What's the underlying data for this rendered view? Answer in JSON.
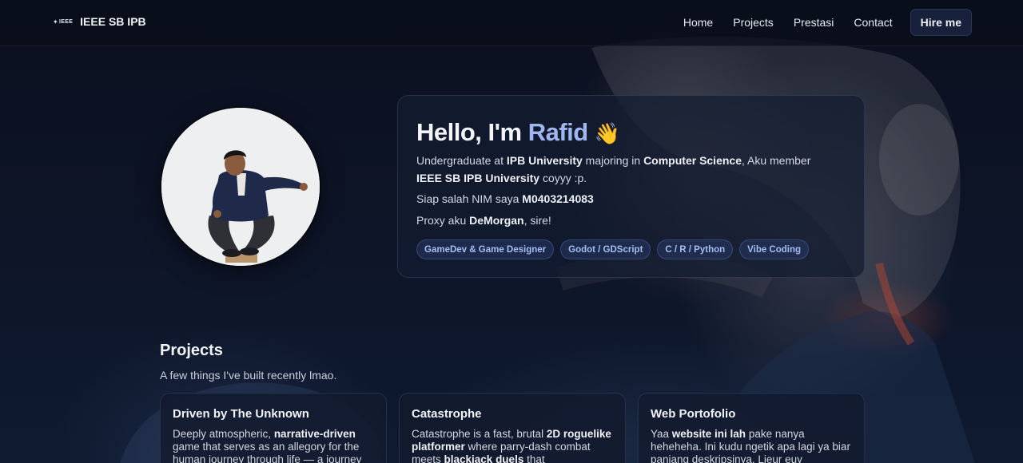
{
  "header": {
    "logo_text": "IEEE",
    "brand": "IEEE SB IPB",
    "nav": [
      "Home",
      "Projects",
      "Prestasi",
      "Contact"
    ],
    "cta": "Hire me"
  },
  "intro": {
    "greeting": "Hello, I'm ",
    "name": "Rafid",
    "wave": "👋",
    "p1": {
      "t1": "Undergraduate at ",
      "b1": "IPB University",
      "t2": " majoring in ",
      "b2": "Computer Science",
      "t3": ", Aku member ",
      "b3": "IEEE SB IPB University",
      "t4": " coyyy :p."
    },
    "p2": {
      "t1": "Siap salah NIM saya ",
      "b1": "M0403214083"
    },
    "p3": {
      "t1": "Proxy aku ",
      "b1": "DeMorgan",
      "t2": ", sire!"
    },
    "tags": [
      "GameDev & Game Designer",
      "Godot / GDScript",
      "C / R / Python",
      "Vibe Coding"
    ]
  },
  "projects": {
    "title": "Projects",
    "subtitle": "A few things I've built recently lmao.",
    "cards": [
      {
        "title": "Driven by The Unknown",
        "d1": "Deeply atmospheric, ",
        "b1": "narrative-driven",
        "d2": " game that serves as an allegory for the human journey through life — a journey"
      },
      {
        "title": "Catastrophe",
        "d1": "Catastrophe is a fast, brutal ",
        "b1": "2D roguelike platformer",
        "d2": " where parry-dash combat meets ",
        "b2": "blackjack duels",
        "d3": " that"
      },
      {
        "title": "Web Portofolio",
        "d1": "Yaa ",
        "b1": "website ini lah",
        "d2": " pake nanya heheheha. Ini kudu ngetik apa lagi ya biar panjang deskripsinya. Lieur euy"
      }
    ]
  }
}
